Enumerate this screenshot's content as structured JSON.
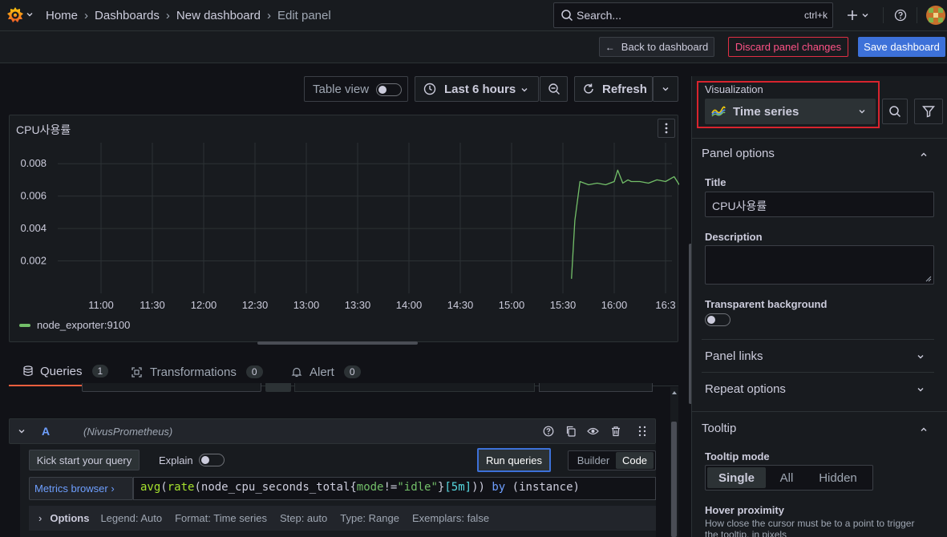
{
  "breadcrumb": [
    "Home",
    "Dashboards",
    "New dashboard",
    "Edit panel"
  ],
  "search": {
    "placeholder": "Search...",
    "shortcut": "ctrl+k"
  },
  "toolbar": {
    "back_label": "Back to dashboard",
    "discard_label": "Discard panel changes",
    "save_label": "Save dashboard"
  },
  "panel_controls": {
    "table_view_label": "Table view",
    "time_range": "Last 6 hours",
    "refresh_label": "Refresh"
  },
  "panel": {
    "title": "CPU사용률",
    "legend": "node_exporter:9100"
  },
  "chart_data": {
    "type": "line",
    "title": "CPU사용률",
    "xlabel": "",
    "ylabel": "",
    "x_ticks": [
      "11:00",
      "11:30",
      "12:00",
      "12:30",
      "13:00",
      "13:30",
      "14:00",
      "14:30",
      "15:00",
      "15:30",
      "16:00",
      "16:3"
    ],
    "y_ticks": [
      "0.008",
      "0.006",
      "0.004",
      "0.002"
    ],
    "ylim": [
      0,
      0.009
    ],
    "grid": true,
    "legend_position": "bottom-left",
    "series": [
      {
        "name": "node_exporter:9100",
        "color": "#73bf69",
        "x": [
          "15:35",
          "15:37",
          "15:40",
          "15:45",
          "15:50",
          "15:55",
          "16:00",
          "16:02",
          "16:05",
          "16:08",
          "16:10",
          "16:15",
          "16:20",
          "16:25",
          "16:30",
          "16:35",
          "16:38"
        ],
        "y": [
          0.0009,
          0.0045,
          0.0069,
          0.0067,
          0.0068,
          0.0067,
          0.0069,
          0.0076,
          0.0068,
          0.007,
          0.0069,
          0.0069,
          0.0068,
          0.007,
          0.0069,
          0.0072,
          0.0067
        ]
      }
    ]
  },
  "query_tabs": [
    {
      "label": "Queries",
      "count": "1"
    },
    {
      "label": "Transformations",
      "count": "0"
    },
    {
      "label": "Alert",
      "count": "0"
    }
  ],
  "query": {
    "ref_id": "A",
    "datasource": "(NivusPrometheus)",
    "kick_start_label": "Kick start your query",
    "explain_label": "Explain",
    "run_label": "Run queries",
    "builder_label": "Builder",
    "code_label": "Code",
    "metrics_browser_label": "Metrics browser ›",
    "expr_parts": [
      "avg",
      "(",
      "rate",
      "(",
      "node_cpu_seconds_total",
      "{",
      "mode",
      "!=",
      "\"idle\"",
      "}",
      "[5m]",
      "))",
      " by ",
      "(instance)"
    ],
    "options_label": "Options",
    "options": [
      "Legend: Auto",
      "Format: Time series",
      "Step: auto",
      "Type: Range",
      "Exemplars: false"
    ]
  },
  "sidebar": {
    "visualization_label": "Visualization",
    "visualization_value": "Time series",
    "panel_options_label": "Panel options",
    "title_label": "Title",
    "title_value": "CPU사용률",
    "description_label": "Description",
    "transparent_label": "Transparent background",
    "panel_links_label": "Panel links",
    "repeat_options_label": "Repeat options",
    "tooltip_label": "Tooltip",
    "tooltip_mode_label": "Tooltip mode",
    "tooltip_modes": [
      "Single",
      "All",
      "Hidden"
    ],
    "hover_label": "Hover proximity",
    "hover_desc": "How close the cursor must be to a point to trigger the tooltip, in pixels"
  }
}
